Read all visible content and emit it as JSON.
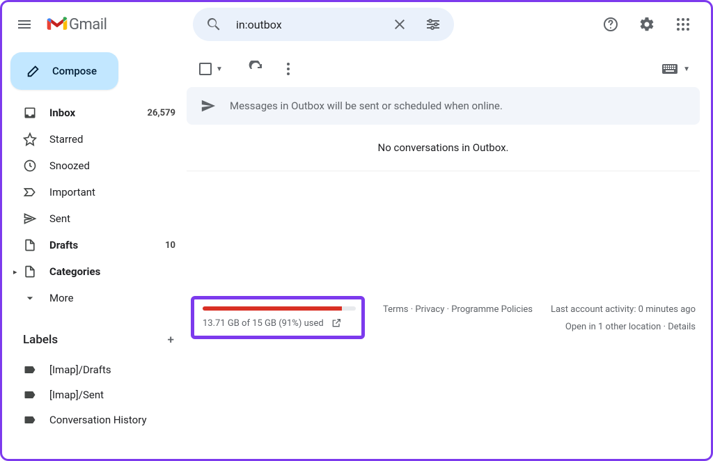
{
  "app": {
    "name": "Gmail"
  },
  "search": {
    "value": "in:outbox"
  },
  "compose": {
    "label": "Compose"
  },
  "nav": [
    {
      "id": "inbox",
      "label": "Inbox",
      "count": "26,579",
      "bold": true,
      "icon": "inbox"
    },
    {
      "id": "starred",
      "label": "Starred",
      "icon": "star"
    },
    {
      "id": "snoozed",
      "label": "Snoozed",
      "icon": "clock"
    },
    {
      "id": "important",
      "label": "Important",
      "icon": "important"
    },
    {
      "id": "sent",
      "label": "Sent",
      "icon": "send"
    },
    {
      "id": "drafts",
      "label": "Drafts",
      "count": "10",
      "bold": true,
      "icon": "file"
    },
    {
      "id": "categories",
      "label": "Categories",
      "bold": true,
      "icon": "file",
      "caret": true
    },
    {
      "id": "more",
      "label": "More",
      "icon": "expand"
    }
  ],
  "labels_header": "Labels",
  "labels": [
    {
      "label": "[Imap]/Drafts"
    },
    {
      "label": "[Imap]/Sent"
    },
    {
      "label": "Conversation History"
    }
  ],
  "banner": "Messages in Outbox will be sent or scheduled when online.",
  "empty": "No conversations in Outbox.",
  "storage": {
    "text": "13.71 GB of 15 GB (91%) used",
    "percent": 91
  },
  "footer_links": {
    "terms": "Terms",
    "privacy": "Privacy",
    "programme": "Programme Policies"
  },
  "activity": {
    "line1": "Last account activity: 0 minutes ago",
    "line2a": "Open in 1 other location",
    "line2b": "Details"
  }
}
